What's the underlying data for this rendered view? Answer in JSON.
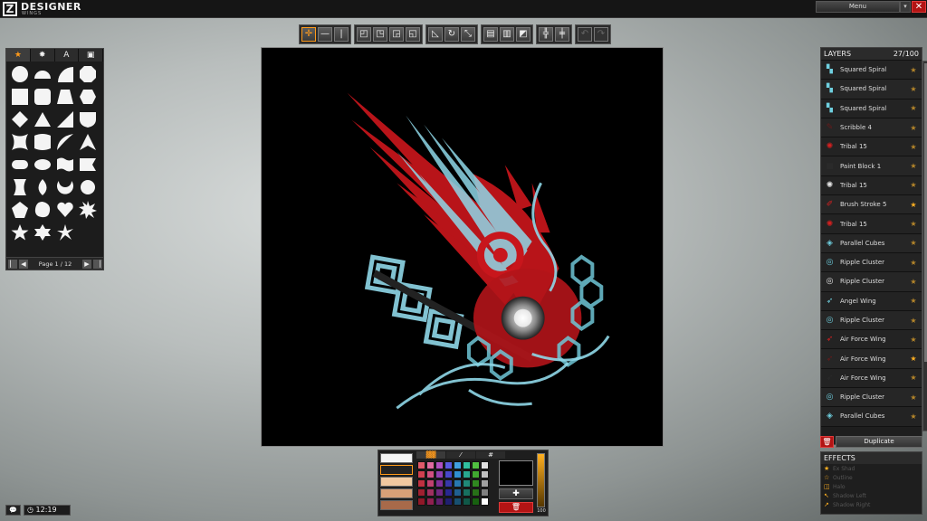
{
  "app": {
    "title": "DESIGNER",
    "subtitle": "WINGS",
    "menu_label": "Menu"
  },
  "shape_panel": {
    "tabs": [
      {
        "icon": "star-icon",
        "glyph": "★"
      },
      {
        "icon": "burst-icon",
        "glyph": "✸"
      },
      {
        "icon": "text-icon",
        "glyph": "A"
      },
      {
        "icon": "image-icon",
        "glyph": "▣"
      }
    ],
    "page_label": "Page 1 / 12",
    "shapes": [
      "circle",
      "half-circle",
      "quarter-circle",
      "octagon-rounded",
      "square",
      "rounded-square",
      "trapezoid",
      "hexagon",
      "diamond",
      "triangle",
      "right-triangle",
      "shield",
      "concave-square",
      "curved-square",
      "crescent-corner",
      "arrow-triangle",
      "capsule",
      "oval",
      "flag",
      "ribbon",
      "hourglass",
      "teardrop",
      "crescent",
      "sunburst",
      "pentagon-badge",
      "blob",
      "heart",
      "starburst",
      "star",
      "star-6",
      "star-spiral"
    ]
  },
  "toolbar": {
    "groups": [
      [
        "move-icon",
        "horizontal-bar-icon",
        "vertical-bar-icon"
      ],
      [
        "align-front-icon",
        "align-back-icon",
        "align-up-icon",
        "align-down-icon"
      ],
      [
        "skew-icon",
        "rotate-icon",
        "scale-icon"
      ],
      [
        "mirror-icon",
        "flip-icon",
        "gradient-icon"
      ],
      [
        "group-icon",
        "ungroup-icon"
      ],
      [
        "undo-icon",
        "redo-icon"
      ]
    ]
  },
  "layers": {
    "title": "LAYERS",
    "count": "27/100",
    "items": [
      {
        "name": "Squared Spiral",
        "thumb": "squared-spiral-icon",
        "color": "#6fd0e0",
        "fav": false
      },
      {
        "name": "Squared Spiral",
        "thumb": "squared-spiral-icon",
        "color": "#6fd0e0",
        "fav": false
      },
      {
        "name": "Squared Spiral",
        "thumb": "squared-spiral-icon",
        "color": "#6fd0e0",
        "fav": false
      },
      {
        "name": "Scribble 4",
        "thumb": "scribble-icon",
        "color": "#6a1a1a",
        "fav": false
      },
      {
        "name": "Tribal 15",
        "thumb": "tribal-icon",
        "color": "#d42020",
        "fav": false
      },
      {
        "name": "Paint Block 1",
        "thumb": "paint-block-icon",
        "color": "#2a2a2a",
        "fav": false
      },
      {
        "name": "Tribal 15",
        "thumb": "tribal-icon",
        "color": "#e8e8e8",
        "fav": false
      },
      {
        "name": "Brush Stroke 5",
        "thumb": "brush-stroke-icon",
        "color": "#d42020",
        "fav": true
      },
      {
        "name": "Tribal 15",
        "thumb": "tribal-icon",
        "color": "#d42020",
        "fav": false
      },
      {
        "name": "Parallel Cubes",
        "thumb": "cubes-icon",
        "color": "#6fd0e0",
        "fav": false
      },
      {
        "name": "Ripple Cluster",
        "thumb": "ripple-icon",
        "color": "#6fd0e0",
        "fav": false
      },
      {
        "name": "Ripple Cluster",
        "thumb": "ripple-icon",
        "color": "#e8e8e8",
        "fav": false
      },
      {
        "name": "Angel Wing",
        "thumb": "wing-icon",
        "color": "#6fd0e0",
        "fav": false
      },
      {
        "name": "Ripple Cluster",
        "thumb": "ripple-icon",
        "color": "#6fd0e0",
        "fav": false
      },
      {
        "name": "Air Force Wing",
        "thumb": "wing-icon",
        "color": "#d42020",
        "fav": false
      },
      {
        "name": "Air Force Wing",
        "thumb": "wing-icon",
        "color": "#6a1a1a",
        "fav": true
      },
      {
        "name": "Air Force Wing",
        "thumb": "wing-icon",
        "color": "#2a2a2a",
        "fav": false
      },
      {
        "name": "Ripple Cluster",
        "thumb": "ripple-icon",
        "color": "#6fd0e0",
        "fav": false
      },
      {
        "name": "Parallel Cubes",
        "thumb": "cubes-icon",
        "color": "#6fd0e0",
        "fav": false
      }
    ],
    "duplicate_label": "Duplicate"
  },
  "effects": {
    "title": "EFFECTS",
    "items": [
      "Ex Shad",
      "Outline",
      "Halo",
      "Shadow Left",
      "Shadow Right"
    ]
  },
  "clock": {
    "time": "12:19"
  },
  "color_panel": {
    "swatches": [
      "#f4f4f4",
      "#222222",
      "#f0c8a0",
      "#d8a078",
      "#a86a4a"
    ],
    "tabs": [
      "▓▓",
      "⁄",
      "#"
    ],
    "palette": [
      "#e05a6a",
      "#e06aa0",
      "#b050c0",
      "#5a5ae0",
      "#40a0e0",
      "#30c0a0",
      "#50c040",
      "#c0c040",
      "#d04050",
      "#d05080",
      "#9040b0",
      "#4848c8",
      "#3090d0",
      "#28a890",
      "#40a830",
      "#a8a830",
      "#c03040",
      "#c04070",
      "#803098",
      "#3838a8",
      "#2878b0",
      "#208878",
      "#308820",
      "#909020",
      "#a02030",
      "#a03060",
      "#702880",
      "#282890",
      "#206090",
      "#187060",
      "#287018",
      "#787818",
      "#901828",
      "#902050",
      "#602070",
      "#202070",
      "#185070",
      "#105848",
      "#186010",
      "#606010"
    ],
    "palette_extra": [
      "#e0e0e0",
      "#c0c0c0",
      "#a0a0a0",
      "#808080",
      "#ffffff",
      "#d8b888",
      "#e08820",
      "#f0a020"
    ],
    "alpha": "100",
    "preview": "#000000"
  }
}
